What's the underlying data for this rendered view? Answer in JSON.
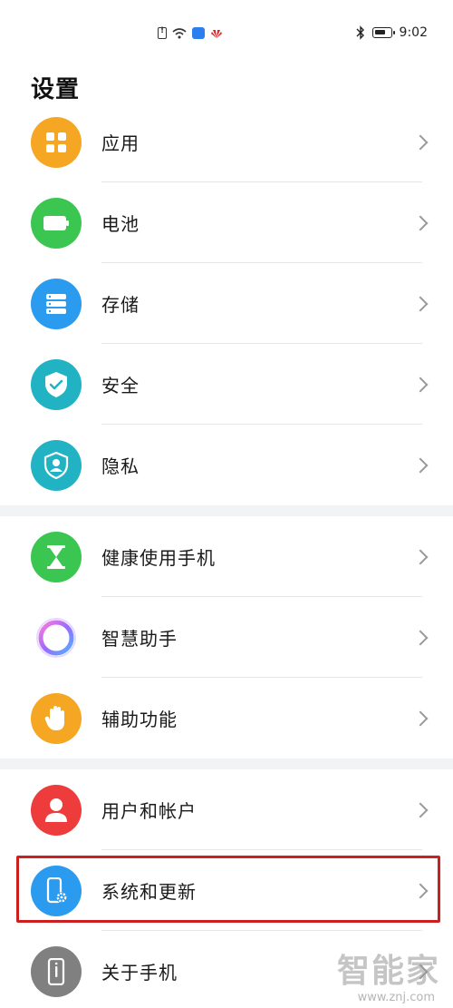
{
  "status_bar": {
    "time": "9:02",
    "icons": [
      "sim-alert-icon",
      "wifi-icon",
      "cloud-app-icon",
      "huawei-logo-icon",
      "bluetooth-icon",
      "battery-icon"
    ]
  },
  "header": {
    "title": "设置"
  },
  "groups": [
    {
      "items": [
        {
          "label": "应用",
          "icon": "apps-grid-icon",
          "color": "#f5a623"
        },
        {
          "label": "电池",
          "icon": "battery-icon",
          "color": "#3bc551"
        },
        {
          "label": "存储",
          "icon": "storage-icon",
          "color": "#2b9bf0"
        },
        {
          "label": "安全",
          "icon": "security-shield-icon",
          "color": "#21b3c4"
        },
        {
          "label": "隐私",
          "icon": "privacy-icon",
          "color": "#21b3c4"
        }
      ]
    },
    {
      "items": [
        {
          "label": "健康使用手机",
          "icon": "hourglass-icon",
          "color": "#3bc551"
        },
        {
          "label": "智慧助手",
          "icon": "smart-assistant-icon",
          "color": "#ffffff"
        },
        {
          "label": "辅助功能",
          "icon": "accessibility-hand-icon",
          "color": "#f5a623"
        }
      ]
    },
    {
      "items": [
        {
          "label": "用户和帐户",
          "icon": "user-icon",
          "color": "#ee3b3b"
        },
        {
          "label": "系统和更新",
          "icon": "system-update-icon",
          "color": "#2b9bf0"
        },
        {
          "label": "关于手机",
          "icon": "about-phone-icon",
          "color": "#808080"
        }
      ]
    }
  ],
  "watermark": {
    "text": "智能家",
    "url": "www.znj.com"
  }
}
